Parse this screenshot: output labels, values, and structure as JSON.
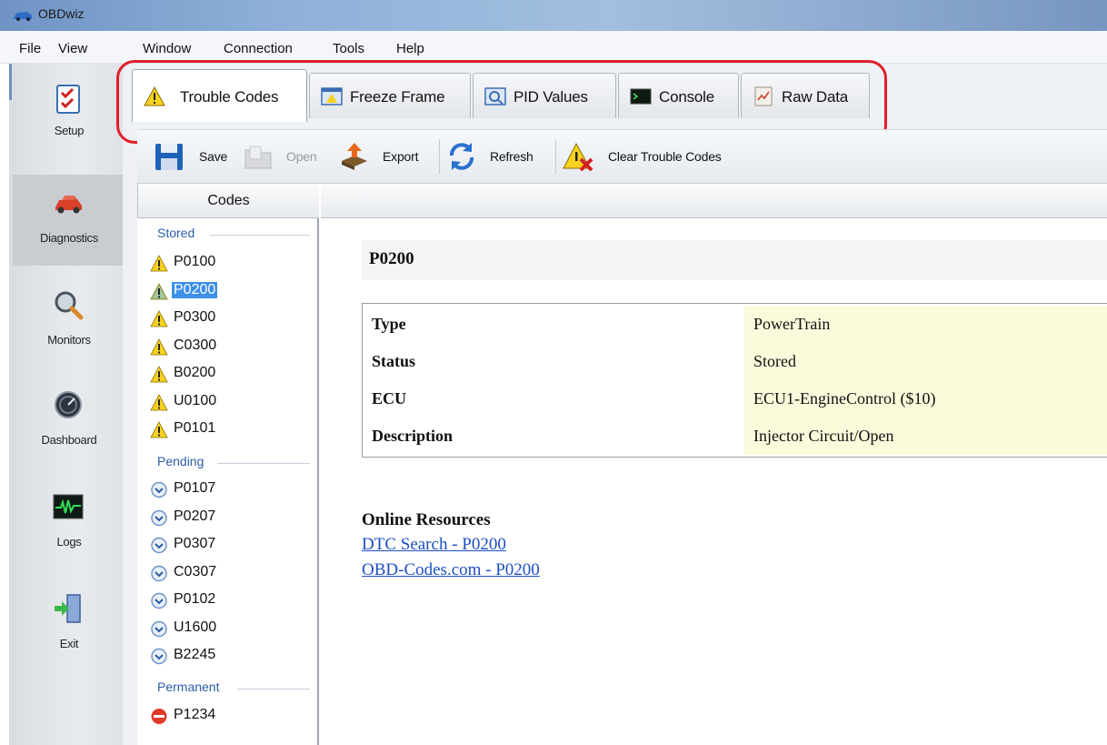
{
  "window": {
    "title": "OBDwiz"
  },
  "menu": {
    "items": [
      "File",
      "View",
      "Window",
      "Connection",
      "Tools",
      "Help"
    ]
  },
  "nav": {
    "items": [
      {
        "label": "Setup",
        "icon": "checklist-icon"
      },
      {
        "label": "Diagnostics",
        "icon": "car-icon"
      },
      {
        "label": "Monitors",
        "icon": "magnifier-icon"
      },
      {
        "label": "Dashboard",
        "icon": "gauge-icon"
      },
      {
        "label": "Logs",
        "icon": "waveform-icon"
      },
      {
        "label": "Exit",
        "icon": "exit-door-icon"
      }
    ],
    "active": "Diagnostics"
  },
  "tabs": [
    {
      "label": "Trouble Codes",
      "icon": "warning-icon"
    },
    {
      "label": "Freeze Frame",
      "icon": "freeze-frame-icon"
    },
    {
      "label": "PID Values",
      "icon": "pid-values-icon"
    },
    {
      "label": "Console",
      "icon": "console-icon"
    },
    {
      "label": "Raw Data",
      "icon": "raw-data-icon"
    }
  ],
  "active_tab": "Trouble Codes",
  "toolbar": {
    "save": "Save",
    "open": "Open",
    "export": "Export",
    "refresh": "Refresh",
    "clear": "Clear Trouble Codes"
  },
  "codes": {
    "header": "Codes",
    "groups": {
      "stored": {
        "label": "Stored",
        "items": [
          "P0100",
          "P0200",
          "P0300",
          "C0300",
          "B0200",
          "U0100",
          "P0101"
        ]
      },
      "pending": {
        "label": "Pending",
        "items": [
          "P0107",
          "P0207",
          "P0307",
          "C0307",
          "P0102",
          "U1600",
          "B2245"
        ]
      },
      "permanent": {
        "label": "Permanent",
        "items": [
          "P1234"
        ]
      }
    },
    "selected": "P0200"
  },
  "detail": {
    "title": "P0200",
    "rows": [
      {
        "key": "Type",
        "value": "PowerTrain"
      },
      {
        "key": "Status",
        "value": "Stored"
      },
      {
        "key": "ECU",
        "value": "ECU1-EngineControl ($10)"
      },
      {
        "key": "Description",
        "value": "Injector Circuit/Open"
      }
    ],
    "resources_title": "Online Resources",
    "links": [
      "DTC Search - P0200",
      "OBD-Codes.com - P0200"
    ]
  },
  "colors": {
    "highlight": "#e0202a",
    "selection": "#3d8fe6",
    "link": "#1d4fc2",
    "group_label": "#2b5ca8",
    "value_cell": "#fbfbdc"
  }
}
